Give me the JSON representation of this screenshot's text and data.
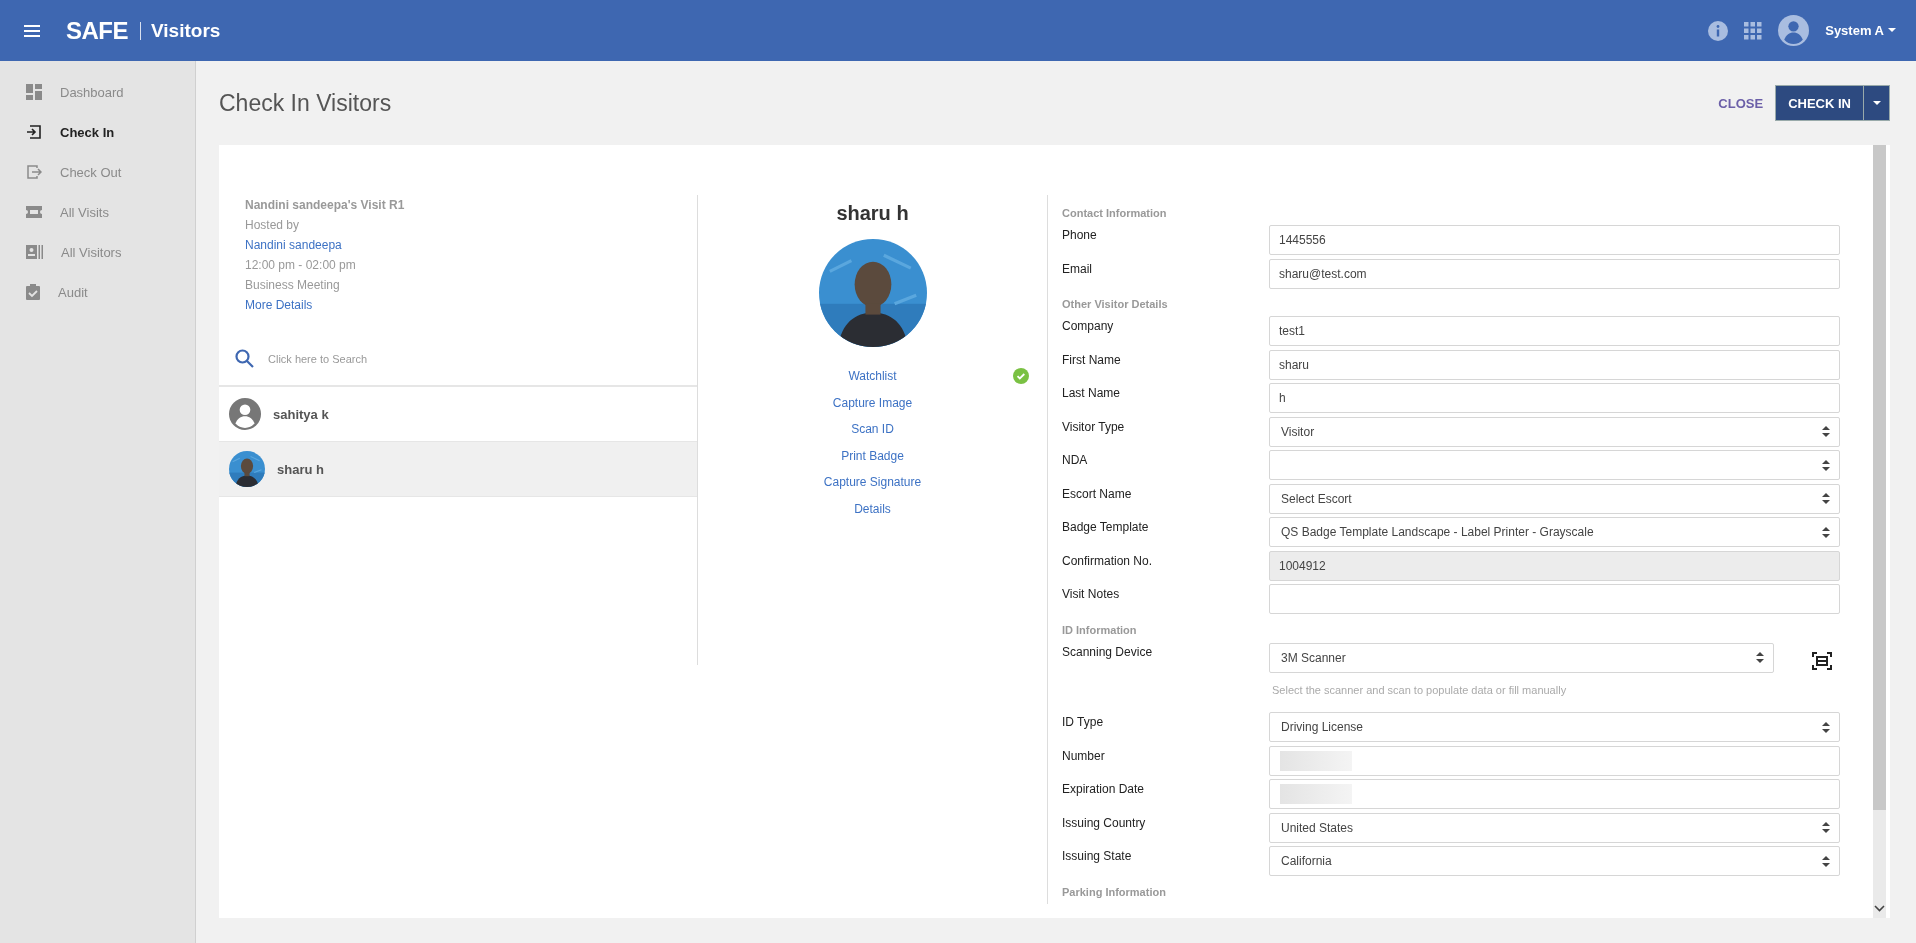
{
  "header": {
    "logo": "SAFE",
    "app_name": "Visitors",
    "user": "System A"
  },
  "sidebar": {
    "items": [
      {
        "label": "Dashboard",
        "selected": false
      },
      {
        "label": "Check In",
        "selected": true
      },
      {
        "label": "Check Out",
        "selected": false
      },
      {
        "label": "All Visits",
        "selected": false
      },
      {
        "label": "All Visitors",
        "selected": false
      },
      {
        "label": "Audit",
        "selected": false
      }
    ]
  },
  "page": {
    "title": "Check In Visitors",
    "close": "CLOSE",
    "primary": "CHECK IN"
  },
  "visit": {
    "title": "Nandini sandeepa's Visit R1",
    "hosted_by": "Hosted by",
    "host": "Nandini sandeepa",
    "time": "12:00 pm - 02:00 pm",
    "type": "Business Meeting",
    "more": "More Details"
  },
  "search": {
    "placeholder": "Click here to Search"
  },
  "visitors": [
    {
      "name": "sahitya k",
      "selected": false
    },
    {
      "name": "sharu h",
      "selected": true
    }
  ],
  "profile": {
    "name": "sharu h",
    "actions": [
      {
        "label": "Watchlist",
        "verified": true
      },
      {
        "label": "Capture Image",
        "verified": false
      },
      {
        "label": "Scan ID",
        "verified": false
      },
      {
        "label": "Print Badge",
        "verified": false
      },
      {
        "label": "Capture Signature",
        "verified": false
      },
      {
        "label": "Details",
        "verified": false
      }
    ]
  },
  "form": {
    "sections": [
      {
        "title": "Contact Information",
        "fields": [
          {
            "label": "Phone",
            "kind": "text",
            "value": "1445556"
          },
          {
            "label": "Email",
            "kind": "text",
            "value": "sharu@test.com"
          }
        ]
      },
      {
        "title": "Other Visitor Details",
        "fields": [
          {
            "label": "Company",
            "kind": "text",
            "value": "test1"
          },
          {
            "label": "First Name",
            "kind": "text",
            "value": "sharu"
          },
          {
            "label": "Last Name",
            "kind": "text",
            "value": "h"
          },
          {
            "label": "Visitor Type",
            "kind": "select",
            "value": "Visitor"
          },
          {
            "label": "NDA",
            "kind": "select"
          },
          {
            "label": "Escort Name",
            "kind": "select",
            "value": "Select Escort"
          },
          {
            "label": "Badge Template",
            "kind": "select",
            "value": "QS Badge Template Landscape - Label Printer - Grayscale"
          },
          {
            "label": "Confirmation No.",
            "kind": "readonly",
            "value": "1004912"
          },
          {
            "label": "Visit Notes",
            "kind": "text"
          }
        ]
      },
      {
        "title": "ID Information",
        "fields": [
          {
            "label": "Scanning Device",
            "kind": "scanner",
            "value": "3M Scanner",
            "hint": "Select the scanner and scan to populate data or fill manually"
          },
          {
            "label": "ID Type",
            "kind": "select",
            "value": "Driving License"
          },
          {
            "label": "Number",
            "kind": "redacted"
          },
          {
            "label": "Expiration Date",
            "kind": "redacted"
          },
          {
            "label": "Issuing Country",
            "kind": "select",
            "value": "United States"
          },
          {
            "label": "Issuing State",
            "kind": "select",
            "value": "California"
          }
        ]
      },
      {
        "title": "Parking Information"
      }
    ]
  }
}
